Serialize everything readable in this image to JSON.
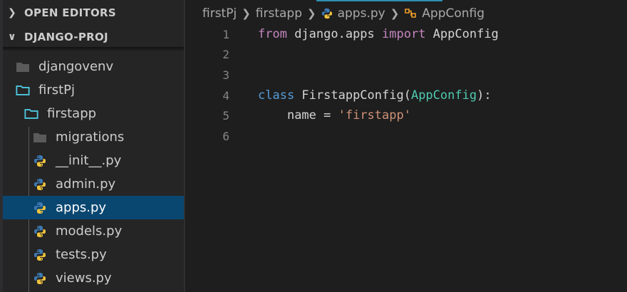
{
  "sidebar": {
    "open_editors_label": "OPEN EDITORS",
    "project_label": "DJANGO-PROJ",
    "items": [
      {
        "label": "djangovenv",
        "type": "folder-closed"
      },
      {
        "label": "firstPj",
        "type": "folder-open"
      },
      {
        "label": "firstapp",
        "type": "folder-open"
      },
      {
        "label": "migrations",
        "type": "folder-closed"
      },
      {
        "label": "__init__.py",
        "type": "python"
      },
      {
        "label": "admin.py",
        "type": "python"
      },
      {
        "label": "apps.py",
        "type": "python",
        "selected": true
      },
      {
        "label": "models.py",
        "type": "python"
      },
      {
        "label": "tests.py",
        "type": "python"
      },
      {
        "label": "views.py",
        "type": "python"
      }
    ]
  },
  "breadcrumb": {
    "parts": [
      "firstPj",
      "firstapp",
      "apps.py",
      "AppConfig"
    ]
  },
  "editor": {
    "line_numbers": [
      "1",
      "2",
      "3",
      "4",
      "5",
      "6"
    ],
    "tokens": {
      "l1_from": "from",
      "l1_module": " django.apps ",
      "l1_import": "import",
      "l1_name": " AppConfig",
      "l4_class": "class",
      "l4_name": " FirstappConfig(",
      "l4_base": "AppConfig",
      "l4_end": "):",
      "l5_indent": "    ",
      "l5_name": "name = ",
      "l5_str": "'firstapp'"
    }
  },
  "colors": {
    "sidebar_bg": "#252526",
    "editor_bg": "#1e1e1e",
    "selection": "#094771",
    "keyword_purple": "#c586c0",
    "keyword_blue": "#569cd6",
    "class_teal": "#4ec9b0",
    "string_orange": "#ce9178"
  }
}
